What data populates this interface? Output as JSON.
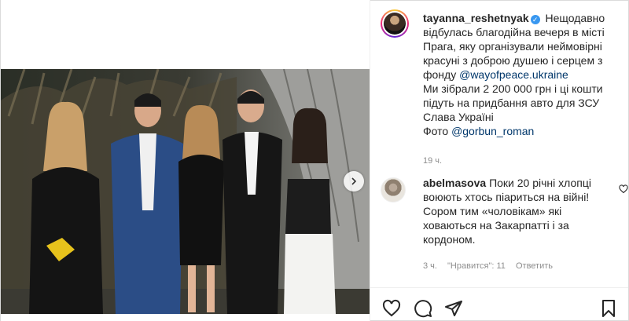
{
  "post": {
    "username": "tayanna_reshetnyak",
    "caption": "Нещодавно відбулась благодійна вечеря в місті Прага, яку організували неймовірні красуні з доброю душею і серцем з фонду",
    "mention_fund": "@wayofpeace.ukraine",
    "caption_line2": "Ми зібрали 2 200 000 грн і ці кошти підуть на придбання авто для ЗСУ",
    "caption_line3": "Слава Україні",
    "photo_prefix": "Фото",
    "mention_photo": "@gorbun_roman",
    "time": "19 ч."
  },
  "comment": {
    "username": "abelmasova",
    "text": "Поки 20 річні хлопці воюють хтось піариться на війні! Сором тим «чоловікам» які ховаються на Закарпатті і за кордоном.",
    "time": "3 ч.",
    "likes": "\"Нравится\": 11",
    "reply": "Ответить"
  },
  "icons": {
    "like": "heart-icon",
    "comment": "comment-icon",
    "share": "share-icon",
    "save": "bookmark-icon",
    "next": "chevron-right-icon",
    "verified": "verified-badge-icon"
  },
  "colors": {
    "link": "#00376b",
    "verified": "#3897f0",
    "muted": "#8e8e8e"
  }
}
